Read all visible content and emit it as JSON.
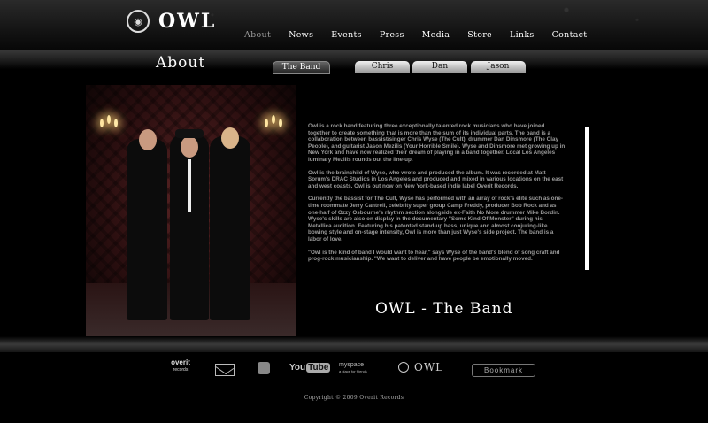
{
  "brand": {
    "logo_text": "OWL"
  },
  "nav": {
    "items": [
      "About",
      "News",
      "Events",
      "Press",
      "Media",
      "Store",
      "Links",
      "Contact"
    ],
    "active": "About"
  },
  "page": {
    "title": "About",
    "tabs": [
      "The Band",
      "Chris",
      "Dan",
      "Jason"
    ],
    "band_title": "OWL - The Band"
  },
  "about": {
    "paragraphs": [
      "Owl is a rock band featuring three exceptionally talented rock musicians who have joined together to create something that is more than the sum of its individual parts. The band is a collaboration between bassist/singer Chris Wyse (The Cult), drummer Dan Dinsmore (The Clay People), and guitarist Jason Mezilis (Your Horrible Smile). Wyse and Dinsmore met growing up in New York and have now realized their dream of playing in a band together. Local Los Angeles luminary Mezilis rounds out the line-up.",
      "Owl is the brainchild of Wyse, who wrote and produced the album. It was recorded at Matt Sorum's DRAC Studios in Los Angeles and produced and mixed in various locations on the east and west coasts. Owl is out now on New York-based indie label Overit Records.",
      "Currently the bassist for The Cult, Wyse has performed with an array of rock's elite such as one-time roommate Jerry Cantrell, celebrity super group Camp Freddy, producer Bob Rock and as one-half of Ozzy Osbourne's rhythm section alongside ex-Faith No More drummer Mike Bordin. Wyse's skills are also on display in the documentary \"Some Kind Of Monster\" during his Metallica audition. Featuring his patented stand-up bass, unique and almost conjuring-like bowing style and on-stage intensity, Owl is more than just Wyse's side project. The band is a labor of love.",
      "\"Owl is the kind of band I would want to hear,\" says Wyse of the band's blend of song craft and prog-rock musicianship. \"We want to deliver and have people be emotionally moved."
    ]
  },
  "footer": {
    "overit_label": "overit",
    "overit_sub": "records",
    "youtube_a": "You",
    "youtube_b": "Tube",
    "myspace_label": "myspace",
    "myspace_sub": "a place for friends",
    "owl_label": "OWL",
    "bookmark_label": "Bookmark",
    "copyright": "Copyright © 2009 Overit Records"
  }
}
